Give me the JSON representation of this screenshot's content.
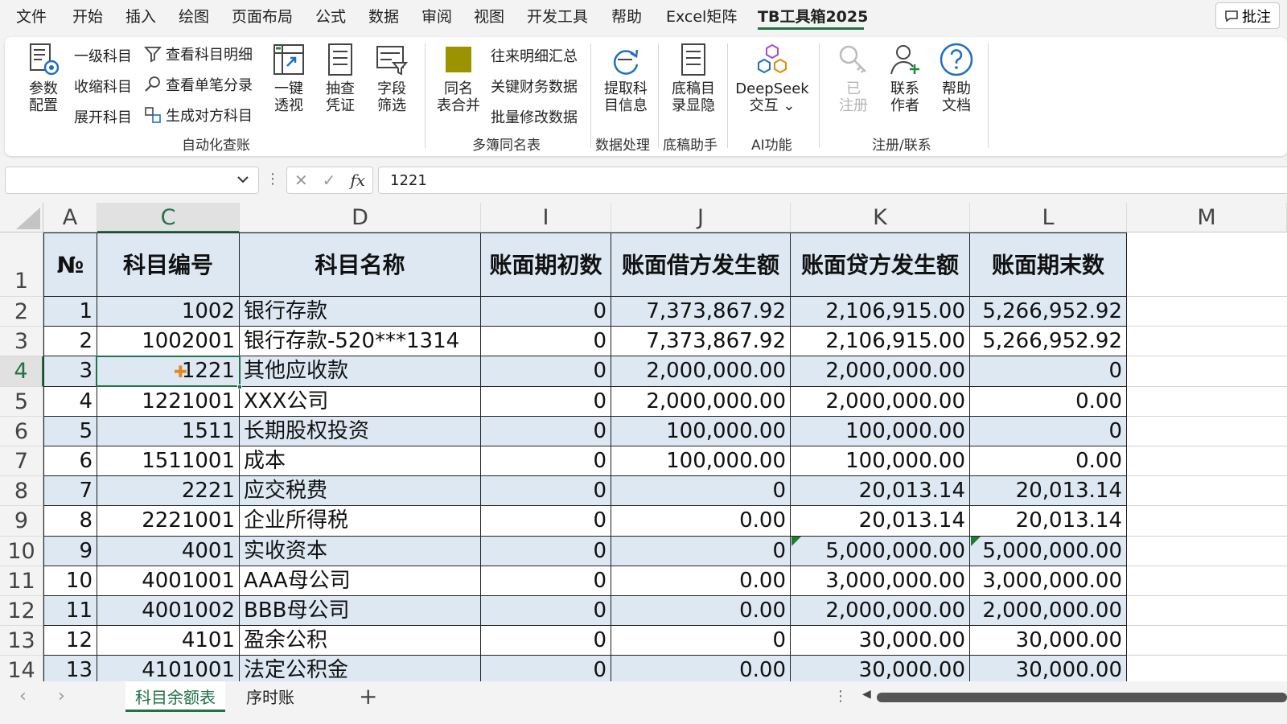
{
  "menu": [
    "文件",
    "开始",
    "插入",
    "绘图",
    "页面布局",
    "公式",
    "数据",
    "审阅",
    "视图",
    "开发工具",
    "帮助",
    "Excel矩阵",
    "TB工具箱2025"
  ],
  "comment_label": "批注",
  "ribbon": {
    "params": "参数\n配置",
    "small1": [
      "一级科目",
      "收缩科目",
      "展开科目"
    ],
    "small2": [
      "查看科目明细",
      "查看单笔分录",
      "生成对方科目"
    ],
    "pivot": "一键\n透视",
    "sample": "抽查\n凭证",
    "filter": "字段\n筛选",
    "group1": "自动化查账",
    "merge": "同名\n表合并",
    "small3": [
      "往来明细汇总",
      "关键财务数据",
      "批量修改数据"
    ],
    "group2": "多簿同名表",
    "extract": "提取科\n目信息",
    "group3": "数据处理",
    "manuscript": "底稿目\n录显隐",
    "group4": "底稿助手",
    "deepseek": "DeepSeek\n交互 ⌄",
    "group5": "AI功能",
    "registered": "已\n注册",
    "contact": "联系\n作者",
    "help": "帮助\n文档",
    "group6": "注册/联系"
  },
  "formula": {
    "namebox": "",
    "value": "1221"
  },
  "columns": [
    "A",
    "C",
    "D",
    "I",
    "J",
    "K",
    "L",
    "M"
  ],
  "headers": [
    "№",
    "科目编号",
    "科目名称",
    "账面期初数",
    "账面借方发生额",
    "账面贷方发生额",
    "账面期末数"
  ],
  "rows": [
    [
      "1",
      "1002",
      "银行存款",
      "0",
      "7,373,867.92",
      "2,106,915.00",
      "5,266,952.92"
    ],
    [
      "2",
      "1002001",
      "银行存款-520***1314",
      "0",
      "7,373,867.92",
      "2,106,915.00",
      "5,266,952.92"
    ],
    [
      "3",
      "1221",
      "其他应收款",
      "0",
      "2,000,000.00",
      "2,000,000.00",
      "0"
    ],
    [
      "4",
      "1221001",
      "XXX公司",
      "0",
      "2,000,000.00",
      "2,000,000.00",
      "0.00"
    ],
    [
      "5",
      "1511",
      "长期股权投资",
      "0",
      "100,000.00",
      "100,000.00",
      "0"
    ],
    [
      "6",
      "1511001",
      "成本",
      "0",
      "100,000.00",
      "100,000.00",
      "0.00"
    ],
    [
      "7",
      "2221",
      "应交税费",
      "0",
      "0",
      "20,013.14",
      "20,013.14"
    ],
    [
      "8",
      "2221001",
      "企业所得税",
      "0",
      "0.00",
      "20,013.14",
      "20,013.14"
    ],
    [
      "9",
      "4001",
      "实收资本",
      "0",
      "0",
      "5,000,000.00",
      "5,000,000.00"
    ],
    [
      "10",
      "4001001",
      "AAA母公司",
      "0",
      "0.00",
      "3,000,000.00",
      "3,000,000.00"
    ],
    [
      "11",
      "4001002",
      "BBB母公司",
      "0",
      "0.00",
      "2,000,000.00",
      "2,000,000.00"
    ],
    [
      "12",
      "4101",
      "盈余公积",
      "0",
      "0",
      "30,000.00",
      "30,000.00"
    ],
    [
      "13",
      "4101001",
      "法定公积金",
      "0",
      "0.00",
      "30,000.00",
      "30,000.00"
    ]
  ],
  "row_numbers": [
    "1",
    "2",
    "3",
    "4",
    "5",
    "6",
    "7",
    "8",
    "9",
    "10",
    "11",
    "12",
    "13",
    "14"
  ],
  "sheets": [
    "科目余额表",
    "序时账"
  ],
  "colors": {
    "accent": "#217346",
    "band": "#dde8f3",
    "ribbon_bg": "#ffffff",
    "chrome": "#f3f3f3"
  }
}
